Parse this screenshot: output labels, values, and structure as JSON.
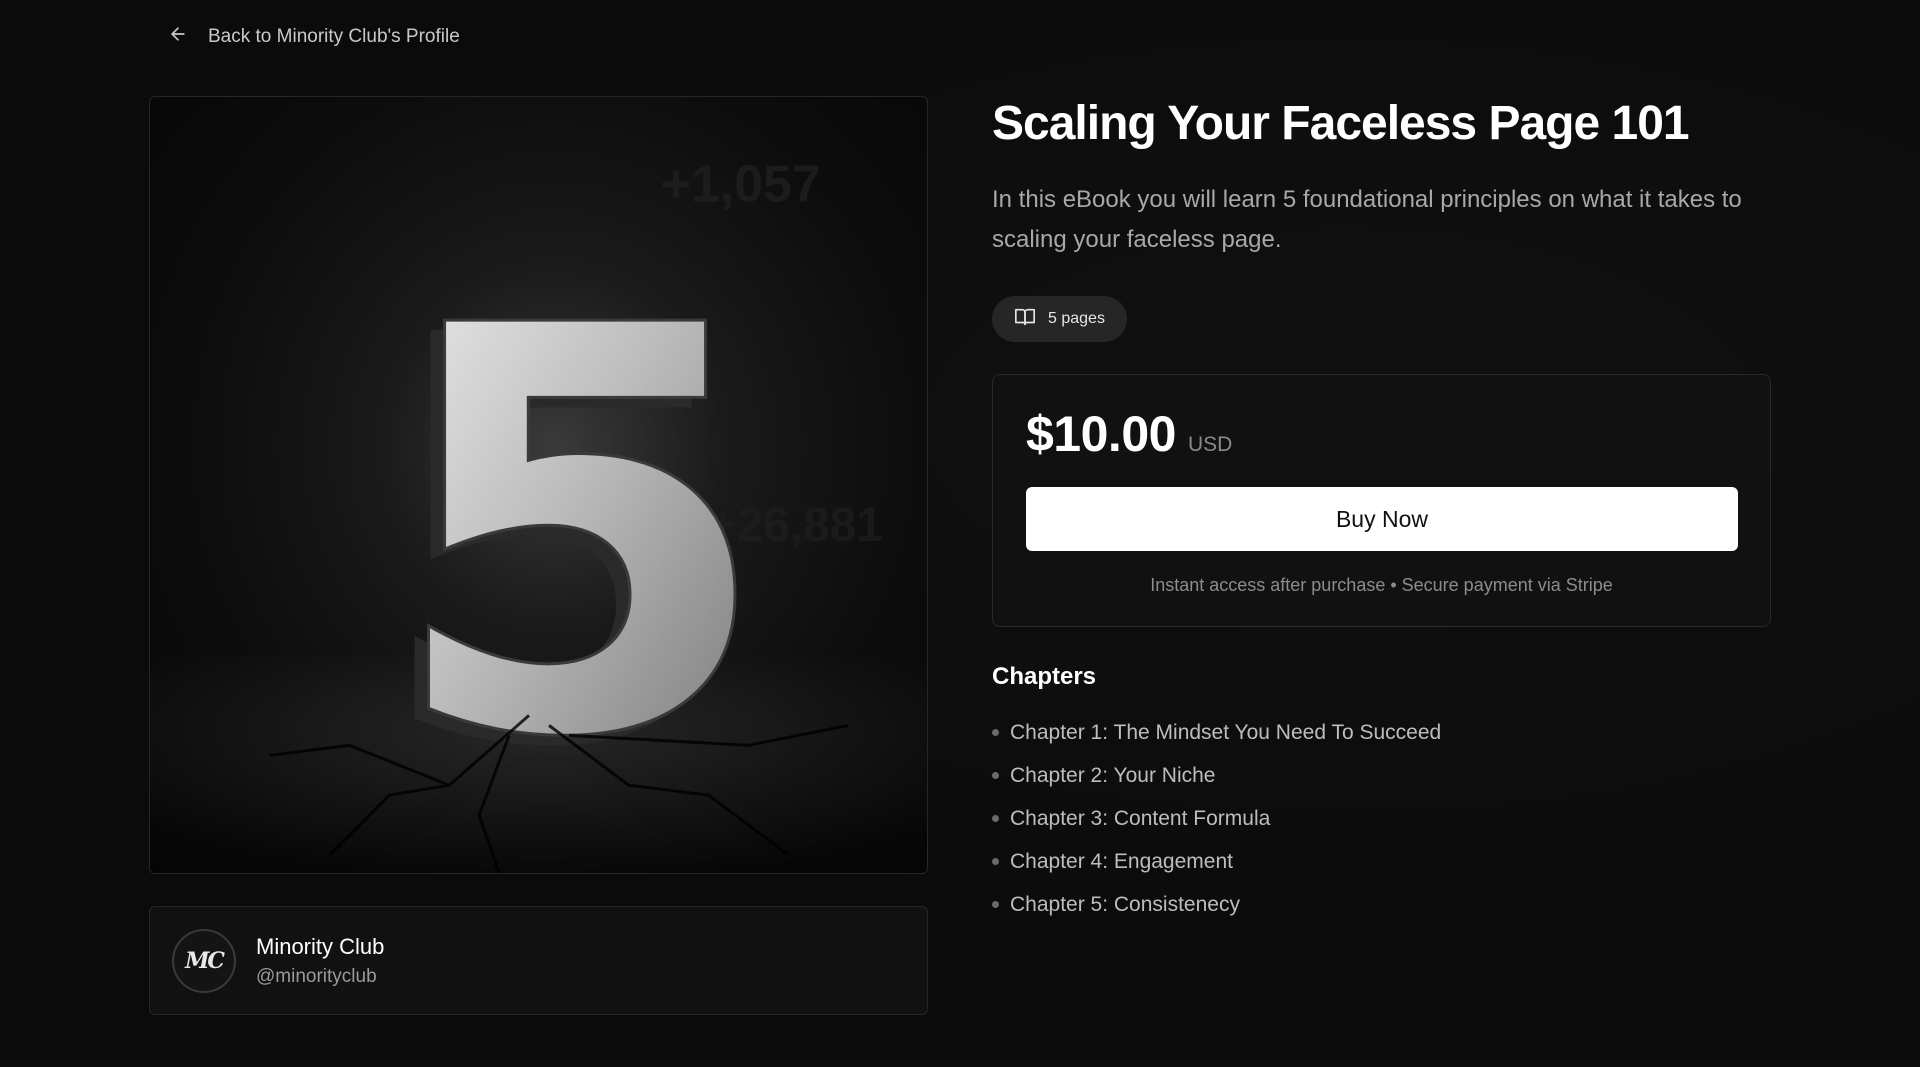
{
  "nav": {
    "back_label": "Back to Minority Club's Profile",
    "back_icon": "arrow-left-icon"
  },
  "cover": {
    "numeral": "5",
    "stat_top": "+1,057",
    "stat_bottom": "+26,881"
  },
  "creator": {
    "avatar_text": "MC",
    "name": "Minority Club",
    "handle": "@minorityclub"
  },
  "product": {
    "title": "Scaling Your Faceless Page 101",
    "description": "In this eBook you will learn 5 foundational principles on what it takes to scaling your faceless page.",
    "pages_label": "5 pages",
    "pages_icon": "book-open-icon"
  },
  "pricing": {
    "price": "$10.00",
    "currency": "USD",
    "buy_label": "Buy Now",
    "note": "Instant access after purchase • Secure payment via Stripe"
  },
  "chapters": {
    "heading": "Chapters",
    "items": [
      "Chapter 1: The Mindset You Need To Succeed",
      "Chapter 2: Your Niche",
      "Chapter 3: Content Formula",
      "Chapter 4: Engagement",
      "Chapter 5: Consistenecy"
    ]
  }
}
